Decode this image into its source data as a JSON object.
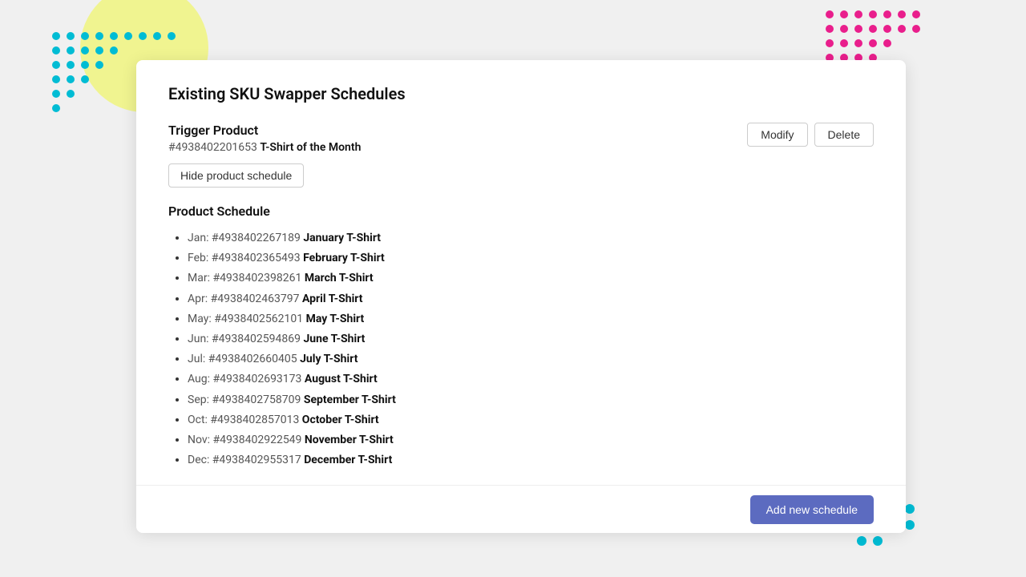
{
  "page": {
    "title": "Existing SKU Swapper Schedules"
  },
  "trigger": {
    "label": "Trigger Product",
    "product_id": "#4938402201653",
    "product_name": "T-Shirt of the Month"
  },
  "buttons": {
    "hide_schedule": "Hide product schedule",
    "modify": "Modify",
    "delete": "Delete",
    "add_schedule": "Add new schedule"
  },
  "schedule": {
    "title": "Product Schedule",
    "items": [
      {
        "month": "Jan",
        "sku": "#4938402267189",
        "name": "January T-Shirt"
      },
      {
        "month": "Feb",
        "sku": "#4938402365493",
        "name": "February T-Shirt"
      },
      {
        "month": "Mar",
        "sku": "#4938402398261",
        "name": "March T-Shirt"
      },
      {
        "month": "Apr",
        "sku": "#4938402463797",
        "name": "April T-Shirt"
      },
      {
        "month": "May",
        "sku": "#4938402562101",
        "name": "May T-Shirt"
      },
      {
        "month": "Jun",
        "sku": "#4938402594869",
        "name": "June T-Shirt"
      },
      {
        "month": "Jul",
        "sku": "#4938402660405",
        "name": "July T-Shirt"
      },
      {
        "month": "Aug",
        "sku": "#4938402693173",
        "name": "August T-Shirt"
      },
      {
        "month": "Sep",
        "sku": "#4938402758709",
        "name": "September T-Shirt"
      },
      {
        "month": "Oct",
        "sku": "#4938402857013",
        "name": "October T-Shirt"
      },
      {
        "month": "Nov",
        "sku": "#4938402922549",
        "name": "November T-Shirt"
      },
      {
        "month": "Dec",
        "sku": "#4938402955317",
        "name": "December T-Shirt"
      }
    ]
  },
  "colors": {
    "teal": "#00bcd4",
    "pink": "#e91e8c",
    "yellow": "#f0f566",
    "purple": "#5c6bc0"
  }
}
